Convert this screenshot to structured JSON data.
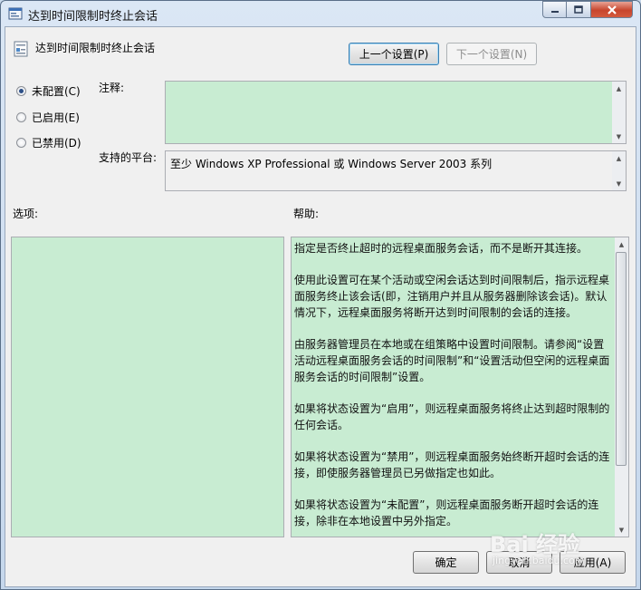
{
  "window": {
    "title": "达到时间限制时终止会话",
    "icon": "policy-setting-icon"
  },
  "window_controls": {
    "minimize_icon": "minimize-icon",
    "maximize_icon": "maximize-icon",
    "close_icon": "close-icon"
  },
  "setting": {
    "name": "达到时间限制时终止会话"
  },
  "nav": {
    "prev_label": "上一个设置(P)",
    "next_label": "下一个设置(N)"
  },
  "state": {
    "options": [
      {
        "label": "未配置(C)",
        "selected": true
      },
      {
        "label": "已启用(E)",
        "selected": false
      },
      {
        "label": "已禁用(D)",
        "selected": false
      }
    ]
  },
  "comment": {
    "label": "注释:",
    "value": ""
  },
  "platform": {
    "label": "支持的平台:",
    "value": "至少 Windows XP Professional 或 Windows Server 2003 系列"
  },
  "options_section": {
    "label": "选项:"
  },
  "help": {
    "label": "帮助:",
    "paragraphs": [
      "指定是否终止超时的远程桌面服务会话，而不是断开其连接。",
      "使用此设置可在某个活动或空闲会话达到时间限制后，指示远程桌面服务终止该会话(即，注销用户并且从服务器删除该会话)。默认情况下，远程桌面服务将断开达到时间限制的会话的连接。",
      "由服务器管理员在本地或在组策略中设置时间限制。请参阅“设置活动远程桌面服务会话的时间限制”和“设置活动但空闲的远程桌面服务会话的时间限制”设置。",
      "如果将状态设置为“启用”，则远程桌面服务将终止达到超时限制的任何会话。",
      "如果将状态设置为“禁用”，则远程桌面服务始终断开超时会话的连接，即使服务器管理员已另做指定也如此。",
      "如果将状态设置为“未配置”，则远程桌面服务断开超时会话的连接，除非在本地设置中另外指定。"
    ]
  },
  "buttons": {
    "ok_label": "确定",
    "cancel_label": "取消",
    "apply_label": "应用(A)"
  },
  "watermark": {
    "brand": "Bai 经验",
    "url": "jingyan.baidu.com"
  },
  "colors": {
    "field_green": "#c8ecd2",
    "dialog_bg": "#f0f0f0",
    "title_bar": "#c5d7ec",
    "close_red": "#c7452d"
  }
}
